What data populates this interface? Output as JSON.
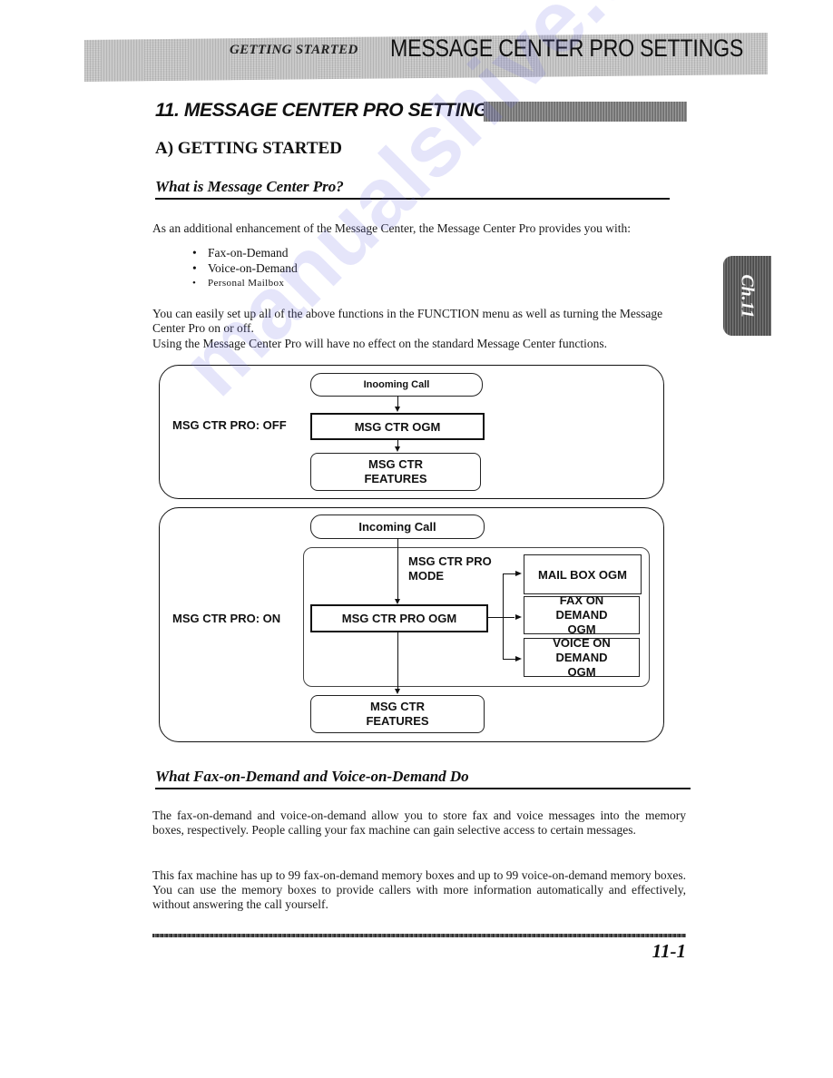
{
  "header": {
    "section": "GETTING STARTED",
    "title": "MESSAGE CENTER PRO SETTINGS"
  },
  "side_tab": {
    "label": "Ch.11"
  },
  "chapter": {
    "title": "11. MESSAGE CENTER PRO SETTINGS"
  },
  "section_a": {
    "heading": "A) GETTING STARTED",
    "subheading": "What is Message Center Pro?",
    "intro": "As an additional enhancement of the Message Center, the Message Center Pro provides you with:",
    "bullets": [
      "Fax-on-Demand",
      "Voice-on-Demand",
      "Personal Mailbox"
    ],
    "para2": "You can easily set up all of the above functions in the FUNCTION menu as well as turning the Message Center Pro on or off.",
    "para3": "Using the Message Center Pro will have no effect on the standard Message Center functions."
  },
  "diagram_off": {
    "mode_label": "MSG CTR PRO: OFF",
    "incoming": "Inooming Call",
    "ogm": "MSG CTR OGM",
    "features": "MSG CTR FEATURES"
  },
  "diagram_on": {
    "mode_label": "MSG CTR PRO: ON",
    "incoming": "Incoming Call",
    "pro_mode": "MSG CTR PRO MODE",
    "pro_ogm": "MSG CTR PRO OGM",
    "outputs": [
      "MAIL BOX OGM",
      "FAX ON DEMAND OGM",
      "VOICE ON DEMAND OGM"
    ],
    "features": "MSG CTR FEATURES"
  },
  "section_b": {
    "subheading": "What Fax-on-Demand and Voice-on-Demand Do",
    "para1": "The fax-on-demand and voice-on-demand allow you to store fax and voice messages into the memory boxes, respectively. People calling your fax machine can gain selective access to certain messages.",
    "para2": "This fax machine has up to 99 fax-on-demand memory boxes and up to 99 voice-on-demand memory boxes. You can use the memory boxes to provide callers with more information automatically and effectively, without answering the call yourself."
  },
  "footer": {
    "page_number": "11-1"
  },
  "watermark": {
    "text": "manualshive.com"
  }
}
